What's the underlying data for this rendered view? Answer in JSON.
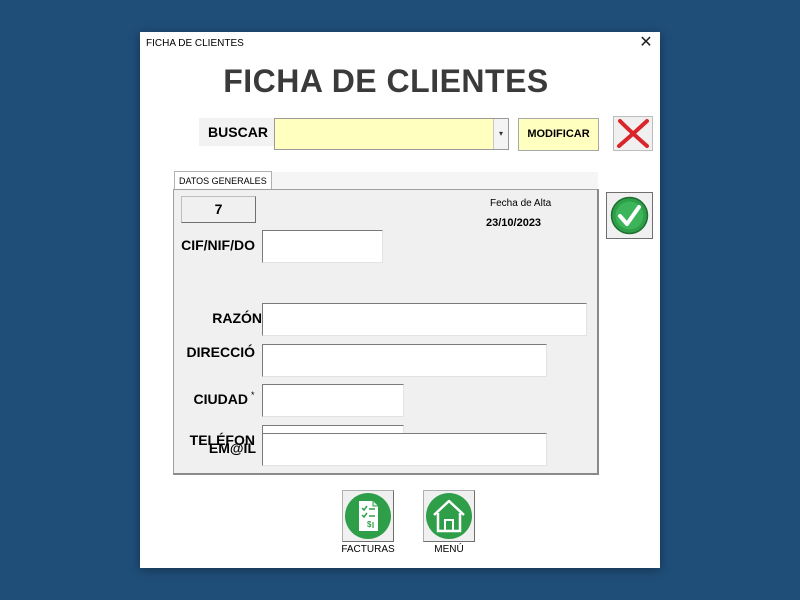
{
  "window": {
    "title_bar": "FICHA DE CLIENTES",
    "close_symbol": "✕"
  },
  "header": {
    "title": "FICHA DE CLIENTES"
  },
  "search": {
    "label": "BUSCAR",
    "value": "",
    "dropdown_arrow": "▾",
    "modify_button": "MODIFICAR",
    "field_color": "#ffffc0"
  },
  "tab": {
    "label": "DATOS GENERALES"
  },
  "record": {
    "id": "7",
    "fecha_label": "Fecha de Alta",
    "fecha_value": "23/10/2023"
  },
  "fields": {
    "cif": {
      "label": "CIF/NIF/DO",
      "value": ""
    },
    "razon": {
      "label": "RAZÓN",
      "value": ""
    },
    "direccio": {
      "label": "DIRECCIÓ",
      "value": ""
    },
    "ciudad": {
      "label": "CIUDAD",
      "required_mark": "*",
      "value": ""
    },
    "telefon": {
      "label": "TELÉFON",
      "value": ""
    },
    "email": {
      "label": "EM@IL",
      "value": ""
    }
  },
  "footer": {
    "facturas_label": "FACTURAS",
    "menu_label": "MENÚ"
  },
  "icons": {
    "cancel": "red-x-icon",
    "accept": "green-checkmark-icon",
    "facturas": "invoice-checklist-icon",
    "menu": "home-icon",
    "green": "#2e9e48",
    "red": "#d9262b"
  }
}
